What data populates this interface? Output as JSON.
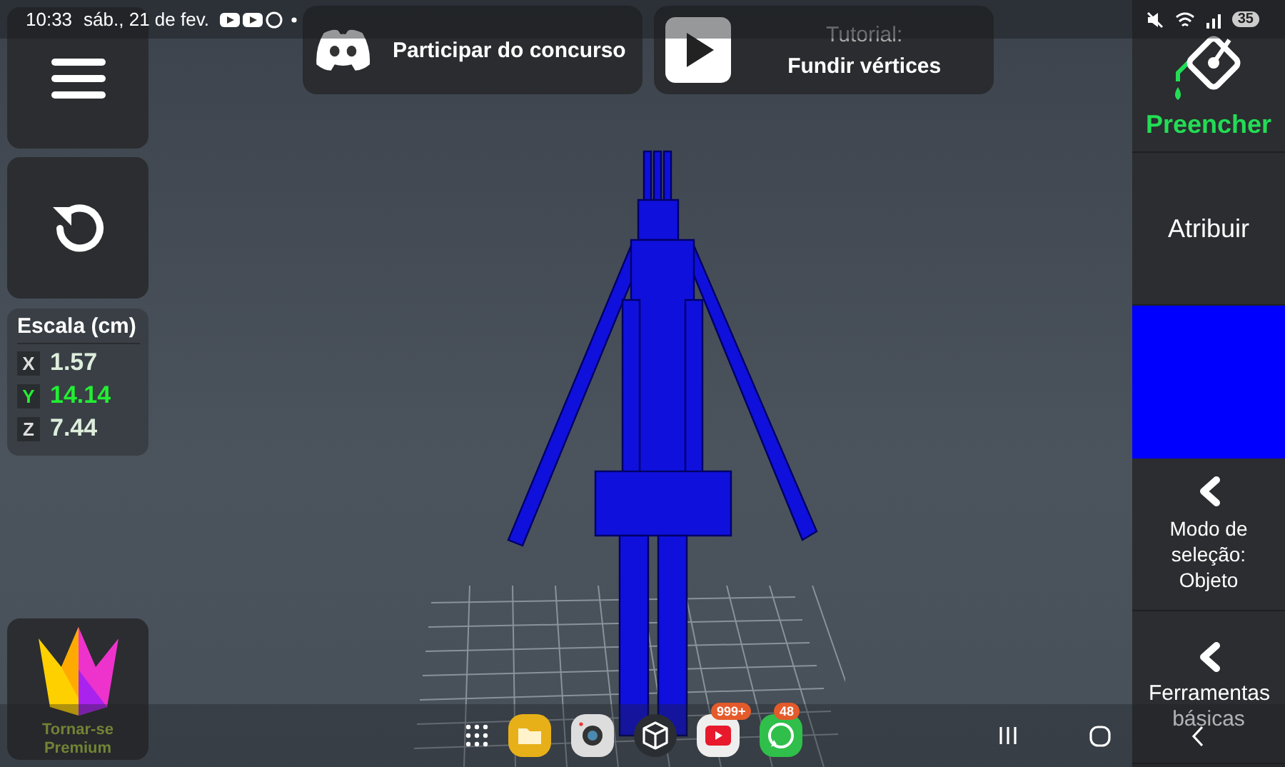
{
  "status_bar": {
    "time": "10:33",
    "date": "sáb., 21 de fev.",
    "battery": "35"
  },
  "promo_cards": [
    {
      "kind": "discord",
      "label": "Participar do concurso"
    },
    {
      "kind": "tutorial",
      "caption": "Tutorial:",
      "label": "Fundir vértices"
    }
  ],
  "scale_panel": {
    "title": "Escala (cm)",
    "axes": [
      {
        "axis": "X",
        "value": "1.57",
        "selected": false
      },
      {
        "axis": "Y",
        "value": "14.14",
        "selected": true
      },
      {
        "axis": "Z",
        "value": "7.44",
        "selected": false
      }
    ]
  },
  "premium_button": {
    "label": "Tornar-se Premium"
  },
  "right_panel": [
    {
      "kind": "tool",
      "label": "Preencher",
      "selected": true
    },
    {
      "kind": "button",
      "label": "Atribuir"
    },
    {
      "kind": "swatch",
      "color": "#0000ff"
    },
    {
      "kind": "menu",
      "label": "Modo de seleção: Objeto"
    },
    {
      "kind": "menu",
      "label": "Ferramentas básicas"
    }
  ],
  "taskbar": {
    "apps": [
      {
        "kind": "grid"
      },
      {
        "kind": "files"
      },
      {
        "kind": "camera"
      },
      {
        "kind": "cube"
      },
      {
        "kind": "youtube",
        "badge": "999+"
      },
      {
        "kind": "whatsapp",
        "badge": "48"
      }
    ]
  }
}
